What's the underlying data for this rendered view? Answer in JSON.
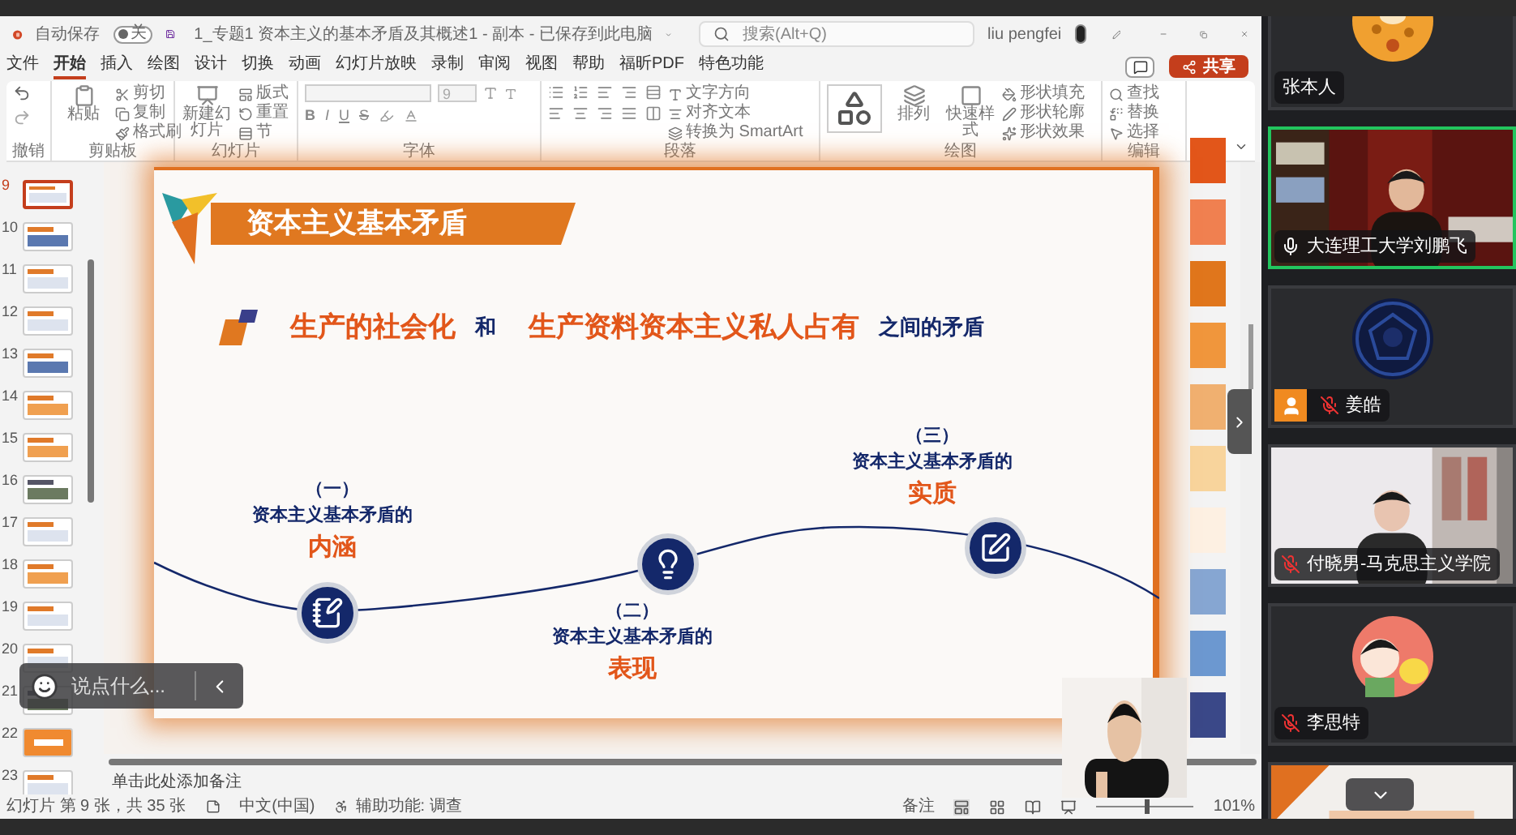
{
  "title_bar": {
    "autosave_label": "自动保存",
    "autosave_state": "关",
    "autosave_on": false,
    "document_title": "1_专题1 资本主义的基本矛盾及其概述1 - 副本 - 已保存到此电脑",
    "search": {
      "placeholder": "搜索(Alt+Q)"
    },
    "user_name": "liu pengfei"
  },
  "menu_tabs": [
    {
      "label": "文件",
      "selected": false
    },
    {
      "label": "开始",
      "selected": true
    },
    {
      "label": "插入",
      "selected": false
    },
    {
      "label": "绘图",
      "selected": false
    },
    {
      "label": "设计",
      "selected": false
    },
    {
      "label": "切换",
      "selected": false
    },
    {
      "label": "动画",
      "selected": false
    },
    {
      "label": "幻灯片放映",
      "selected": false
    },
    {
      "label": "录制",
      "selected": false
    },
    {
      "label": "审阅",
      "selected": false
    },
    {
      "label": "视图",
      "selected": false
    },
    {
      "label": "帮助",
      "selected": false
    },
    {
      "label": "福昕PDF",
      "selected": false
    },
    {
      "label": "特色功能",
      "selected": false
    }
  ],
  "share_button": "共享",
  "ribbon": [
    {
      "label": "撤销",
      "kind": "undo"
    },
    {
      "label": "剪贴板",
      "kind": "clipboard",
      "big": "粘贴",
      "items": [
        "剪切",
        "复制",
        "格式刷"
      ]
    },
    {
      "label": "幻灯片",
      "kind": "slides",
      "big": "新建幻灯片",
      "items": [
        "版式",
        "重置",
        "节"
      ]
    },
    {
      "label": "字体",
      "kind": "font",
      "size": "9",
      "items": [
        "B",
        "I",
        "U",
        "S"
      ]
    },
    {
      "label": "段落",
      "kind": "paragraph",
      "items": [
        "文字方向",
        "对齐文本",
        "转换为 SmartArt"
      ]
    },
    {
      "label": "绘图",
      "kind": "drawing",
      "big": "排列",
      "big2": "快速样式",
      "items": [
        "形状填充",
        "形状轮廓",
        "形状效果"
      ]
    },
    {
      "label": "编辑",
      "kind": "editing",
      "items": [
        "查找",
        "替换",
        "选择"
      ]
    }
  ],
  "thumbnails": [
    {
      "number": "9",
      "kind": "text",
      "selected": true
    },
    {
      "number": "10",
      "kind": "diagram",
      "selected": false
    },
    {
      "number": "11",
      "kind": "text",
      "selected": false
    },
    {
      "number": "12",
      "kind": "text",
      "selected": false
    },
    {
      "number": "13",
      "kind": "diagram",
      "selected": false
    },
    {
      "number": "14",
      "kind": "boxes",
      "selected": false
    },
    {
      "number": "15",
      "kind": "boxes",
      "selected": false
    },
    {
      "number": "16",
      "selected": false
    },
    {
      "number": "17",
      "kind": "text",
      "selected": false
    },
    {
      "number": "18",
      "kind": "boxes",
      "selected": false
    },
    {
      "number": "19",
      "kind": "text",
      "selected": false
    },
    {
      "number": "20",
      "kind": "text",
      "selected": false
    },
    {
      "number": "21",
      "selected": false
    },
    {
      "number": "22",
      "kind": "orange",
      "selected": false
    },
    {
      "number": "23",
      "kind": "text",
      "selected": false
    }
  ],
  "slide": {
    "title": "资本主义基本矛盾",
    "headline": [
      {
        "text": "生产的社会化",
        "kind": "emph"
      },
      {
        "text": "和",
        "kind": "plain"
      },
      {
        "text": "生产资料资本主义私人占有",
        "kind": "emph"
      },
      {
        "text": "之间的矛盾",
        "kind": "plain"
      }
    ],
    "points": [
      {
        "number": "（一）",
        "label": "资本主义基本矛盾的",
        "keyword": "内涵",
        "kind": "notebook"
      },
      {
        "number": "（二）",
        "label": "资本主义基本矛盾的",
        "keyword": "表现",
        "kind": "bulb"
      },
      {
        "number": "（三）",
        "label": "资本主义基本矛盾的",
        "keyword": "实质",
        "kind": "pen"
      }
    ]
  },
  "palette": [
    {
      "color": "#e2561a"
    },
    {
      "color": "#f08050"
    },
    {
      "color": "#e0761c"
    },
    {
      "color": "#f0963c"
    },
    {
      "color": "#f0b070"
    },
    {
      "color": "#f8d49c"
    },
    {
      "color": "#fdf0e2"
    },
    {
      "color": "#86a6d2"
    },
    {
      "color": "#6c98d0"
    },
    {
      "color": "#3a4888"
    }
  ],
  "chat": {
    "placeholder": "说点什么..."
  },
  "notes": {
    "placeholder": "单击此处添加备注"
  },
  "status_bar": {
    "slide_info": "幻灯片 第 9 张，共 35 张",
    "language": "中文(中国)",
    "accessibility": "辅助功能: 调查",
    "notes_button": "备注",
    "zoom": {
      "level": 0.5
    },
    "zoom_reading": "101%"
  },
  "participants": [
    {
      "name": "张本人",
      "kind": "avatar",
      "speaking": false
    },
    {
      "name": "大连理工大学刘鹏飞",
      "kind": "video",
      "muted": false,
      "speaking": true,
      "badge": false
    },
    {
      "name": "姜皓",
      "kind": "avatar",
      "muted": true,
      "speaking": false,
      "badge": true
    },
    {
      "name": "付晓男-马克思主义学院",
      "kind": "video",
      "muted": true,
      "speaking": false,
      "badge": false
    },
    {
      "name": "李思特",
      "kind": "avatar",
      "muted": true,
      "speaking": false,
      "badge": false
    },
    {
      "kind": "video",
      "speaking": false
    }
  ]
}
